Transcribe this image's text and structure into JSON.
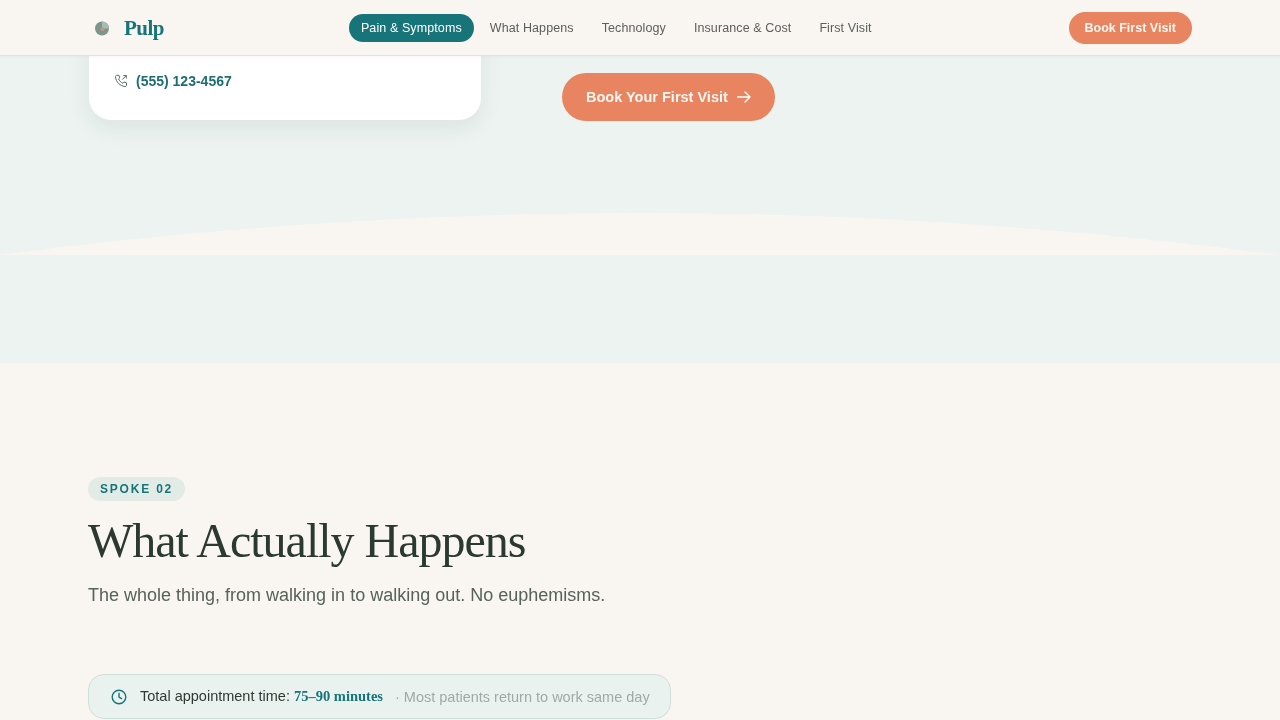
{
  "header": {
    "logo": "Pulp",
    "nav": [
      {
        "label": "Pain & Symptoms",
        "selected": true
      },
      {
        "label": "What Happens",
        "selected": false
      },
      {
        "label": "Technology",
        "selected": false
      },
      {
        "label": "Insurance & Cost",
        "selected": false
      },
      {
        "label": "First Visit",
        "selected": false
      }
    ],
    "cta": "Book First Visit"
  },
  "hero": {
    "contact_card": {
      "phone": "(555) 123-4567"
    },
    "cta": "Book Your First Visit"
  },
  "section": {
    "badge": "SPOKE 02",
    "title": "What Actually Happens",
    "subtitle": "The whole thing, from walking in to walking out. No euphemisms.",
    "info_bar": {
      "text": "Total appointment time: **75–90 minutes**",
      "note": "· Most patients return to work same day"
    }
  }
}
